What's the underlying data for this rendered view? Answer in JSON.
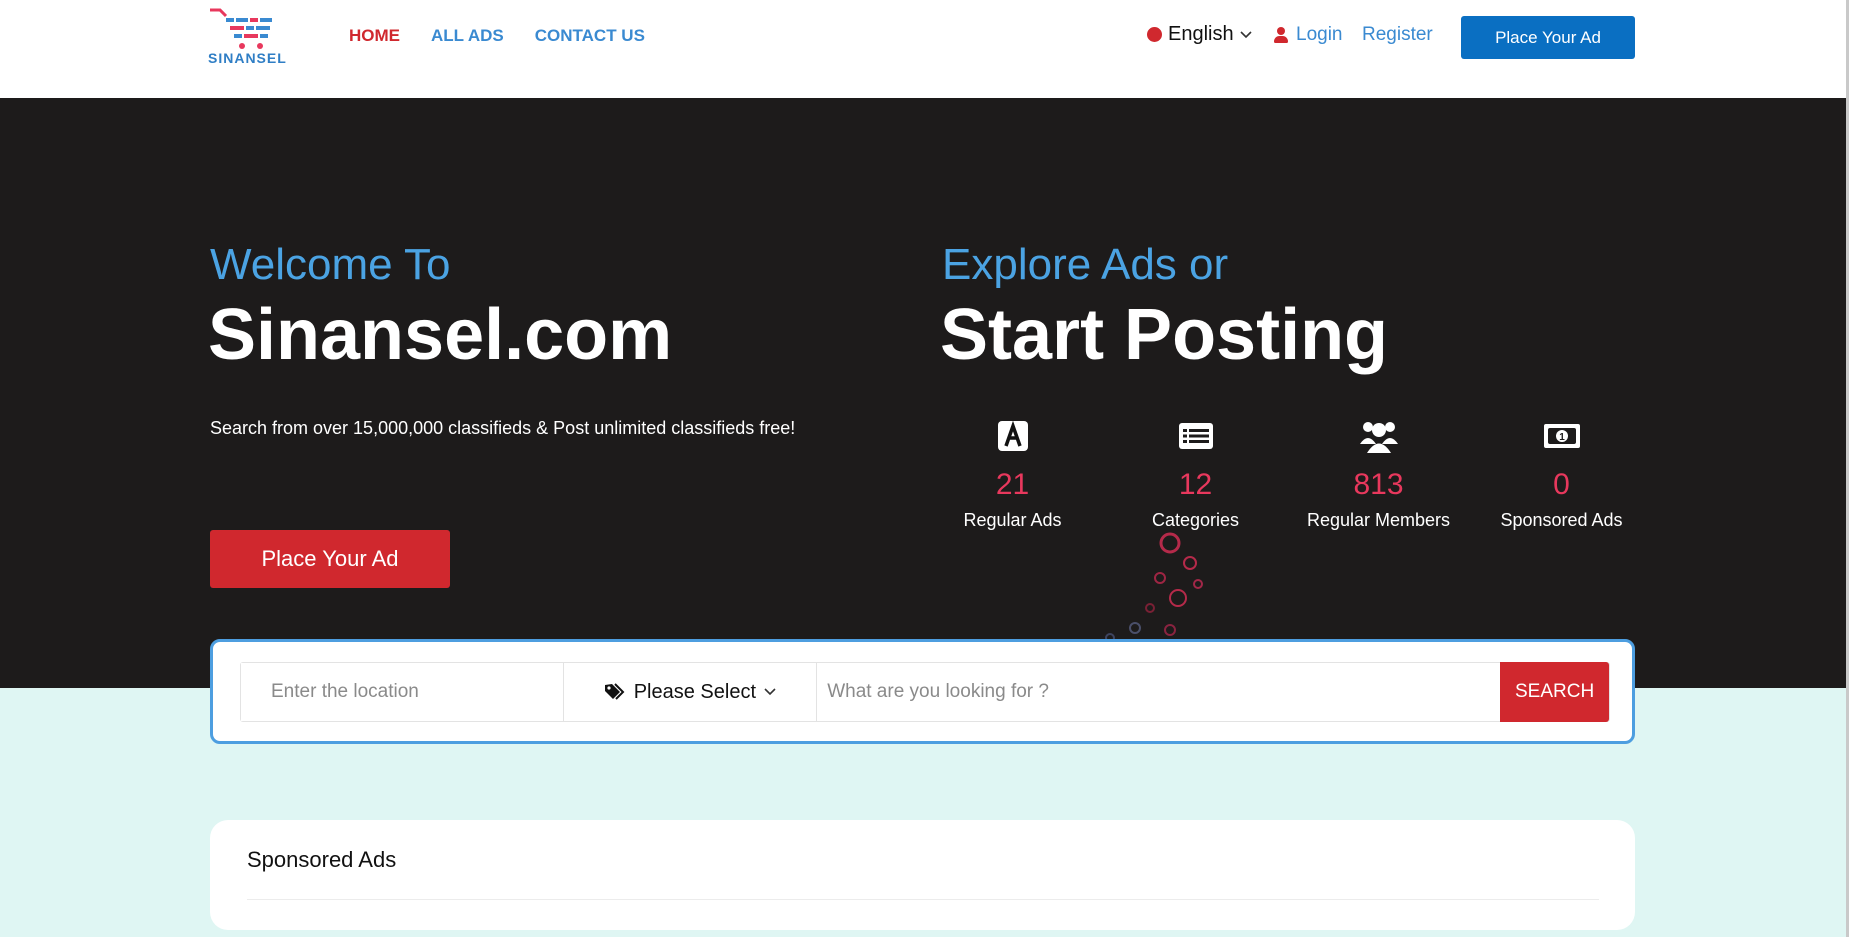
{
  "header": {
    "logo_text": "SINANSEL",
    "nav": [
      {
        "label": "HOME",
        "active": true
      },
      {
        "label": "ALL ADS",
        "active": false
      },
      {
        "label": "CONTACT US",
        "active": false
      }
    ],
    "language": "English",
    "login_label": "Login",
    "register_label": "Register",
    "place_ad_label": "Place Your Ad"
  },
  "hero": {
    "welcome": "Welcome To",
    "site_name": "Sinansel.com",
    "tagline": "Search from over 15,000,000 classifieds & Post unlimited classifieds free!",
    "place_ad_label": "Place Your Ad",
    "explore": "Explore Ads or",
    "start_posting": "Start Posting",
    "stats": [
      {
        "value": "21",
        "label": "Regular Ads",
        "icon": "ads-icon"
      },
      {
        "value": "12",
        "label": "Categories",
        "icon": "list-icon"
      },
      {
        "value": "813",
        "label": "Regular Members",
        "icon": "users-icon"
      },
      {
        "value": "0",
        "label": "Sponsored Ads",
        "icon": "money-icon"
      }
    ]
  },
  "search": {
    "location_placeholder": "Enter the location",
    "category_selected": "Please Select",
    "query_placeholder": "What are you looking for ?",
    "button_label": "SEARCH"
  },
  "sponsored": {
    "title": "Sponsored Ads"
  },
  "colors": {
    "accent_red": "#d0282e",
    "accent_blue": "#0a6fc2",
    "link_blue": "#3a8ad1",
    "hero_bg": "#1d1b1b",
    "stat_number": "#e8385d",
    "page_bg": "#dff6f3"
  }
}
